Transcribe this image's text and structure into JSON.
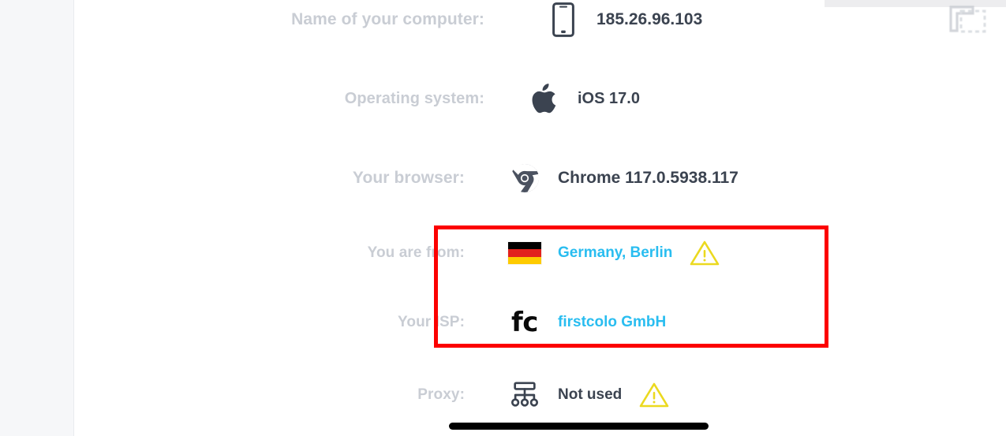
{
  "left_rail": {
    "name": "sidebar-rail"
  },
  "top_right": {
    "copy_icon": "copy-icon"
  },
  "rows": [
    {
      "id": "computer",
      "label": "Name of your computer:",
      "value": "185.26.96.103",
      "icon": "smartphone-icon",
      "warning": false,
      "highlighted": false,
      "link": false
    },
    {
      "id": "os",
      "label": "Operating system:",
      "value": "iOS 17.0",
      "icon": "apple-icon",
      "warning": false,
      "highlighted": false,
      "link": false
    },
    {
      "id": "browser",
      "label": "Your browser:",
      "value": "Chrome 117.0.5938.117",
      "icon": "chrome-icon",
      "warning": false,
      "highlighted": false,
      "link": false
    },
    {
      "id": "country",
      "label": "You are from:",
      "value": "Germany, Berlin",
      "icon": "flag-germany-icon",
      "warning": true,
      "highlighted": true,
      "link": true
    },
    {
      "id": "isp",
      "label": "Your ISP:",
      "value": "firstcolo GmbH",
      "icon": "firstcolo-logo-icon",
      "warning": false,
      "highlighted": true,
      "link": true
    },
    {
      "id": "proxy",
      "label": "Proxy:",
      "value": "Not used",
      "icon": "proxy-network-icon",
      "warning": true,
      "highlighted": false,
      "link": false
    }
  ],
  "isp_logo_text": "fc",
  "colors": {
    "label": "#c9cdd4",
    "value": "#3b4350",
    "link": "#29bdf0",
    "annotation": "#fc0000",
    "warning": "#ebd91f",
    "flag_black": "#000000",
    "flag_red": "#e2211d",
    "flag_gold": "#fecb00",
    "rail": "#f6f7f9",
    "scrollbar": "#000000"
  },
  "scrollbar": {
    "orientation": "horizontal"
  }
}
